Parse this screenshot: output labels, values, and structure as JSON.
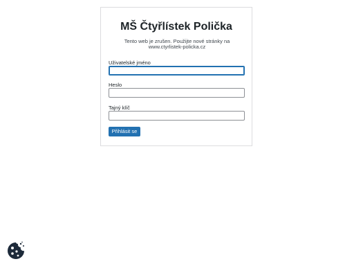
{
  "site": {
    "title": "MŠ Čtyřlístek Polička",
    "notice": "Tento web je zrušen. Použijte nové stránky na www.ctyrlistek-policka.cz"
  },
  "login_form": {
    "username_label": "Uživatelské jméno",
    "username_value": "",
    "password_label": "Heslo",
    "password_value": "",
    "secret_key_label": "Tajný klíč",
    "secret_key_value": "",
    "submit_label": "Přihlásit se"
  },
  "colors": {
    "accent": "#2271b1",
    "cookie_icon": "#1d2a3a"
  },
  "icons": {
    "cookie": "cookie-icon"
  }
}
